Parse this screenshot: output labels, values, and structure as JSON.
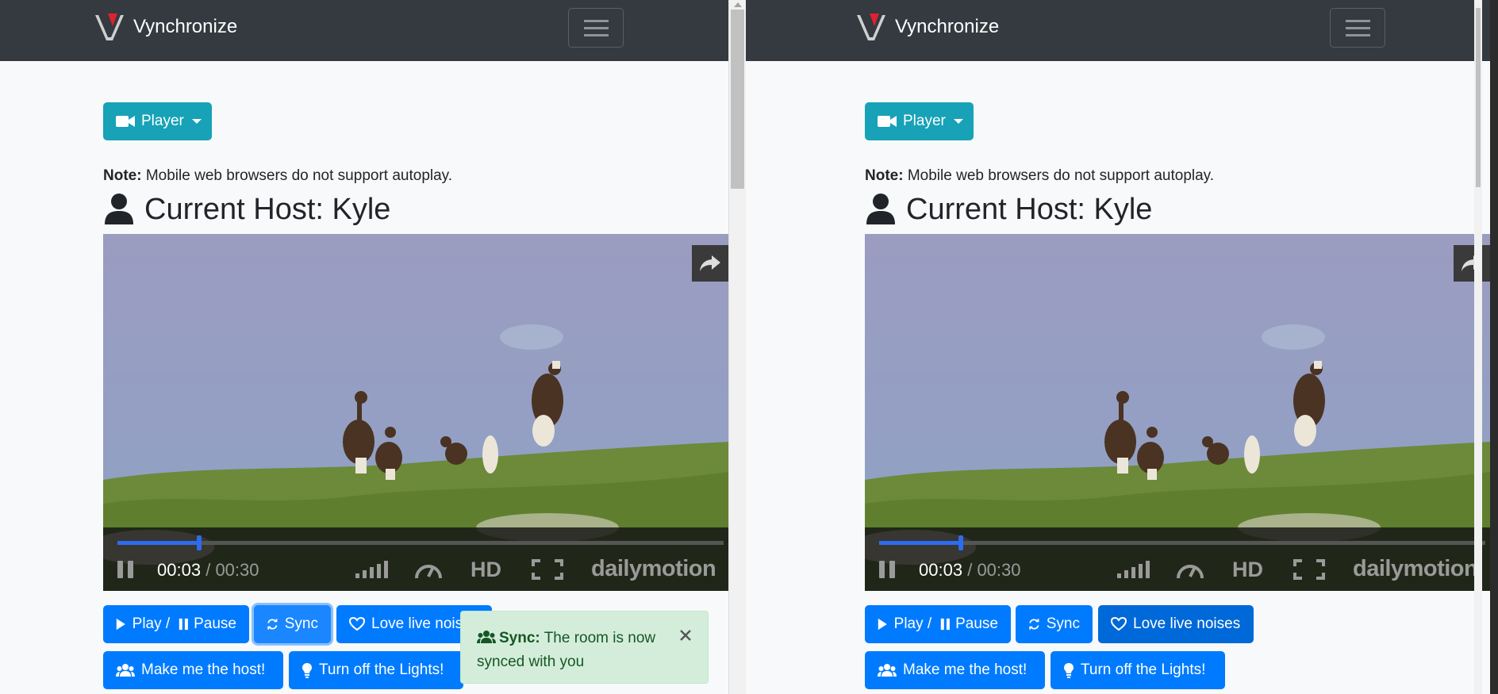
{
  "app": {
    "brand": "Vynchronize"
  },
  "player_dropdown": {
    "label": "Player"
  },
  "note": {
    "bold": "Note:",
    "text": "Mobile web browsers do not support autoplay."
  },
  "host": {
    "label": "Current Host: Kyle"
  },
  "video": {
    "current_time": "00:03",
    "separator": "/",
    "duration": "00:30",
    "quality": "HD",
    "provider": "dailymotion",
    "progress_fraction": 0.135
  },
  "buttons": {
    "play_pause": {
      "play": "Play",
      "sep": " / ",
      "pause": "Pause"
    },
    "sync": "Sync",
    "love": "Love live noises",
    "make_host": "Make me the host!",
    "lights": "Turn off the Lights!"
  },
  "toast": {
    "title": "Sync:",
    "message": "The room is now synced with you"
  },
  "colors": {
    "navbar": "#343a40",
    "info": "#17a2b8",
    "primary": "#007bff",
    "success_bg": "#d4edda",
    "success_text": "#155724"
  }
}
